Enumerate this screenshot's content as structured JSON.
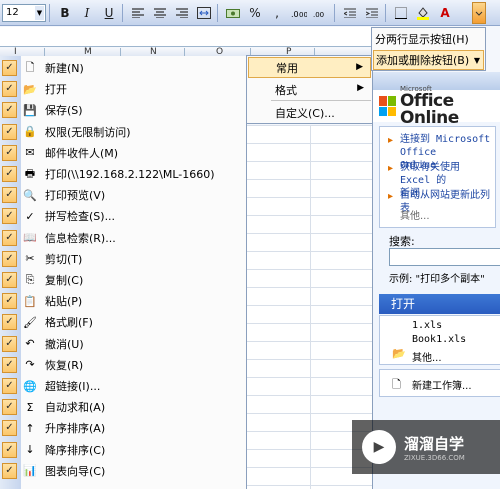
{
  "toolbar": {
    "font_size": "12",
    "buttons": [
      {
        "name": "bold-button",
        "glyph": "B"
      },
      {
        "name": "italic-button",
        "glyph": "I"
      },
      {
        "name": "underline-button",
        "glyph": "U"
      }
    ],
    "percent_glyph": "%",
    "comma_glyph": ",",
    "font_color_glyph": "A"
  },
  "column_headers": [
    "I",
    "M",
    "N",
    "O",
    "P"
  ],
  "commands": [
    {
      "label": "新建(N)",
      "icon": "new-document-icon",
      "glyph": "🗋"
    },
    {
      "label": "打开",
      "icon": "open-folder-icon",
      "glyph": "📂"
    },
    {
      "label": "保存(S)",
      "icon": "save-icon",
      "glyph": "💾"
    },
    {
      "label": "权限(无限制访问)",
      "icon": "permission-icon",
      "glyph": "🔒"
    },
    {
      "label": "邮件收件人(M)",
      "icon": "mail-icon",
      "glyph": "✉"
    },
    {
      "label": "打印(\\\\192.168.2.122\\ML-1660)",
      "icon": "print-icon",
      "glyph": "🖶"
    },
    {
      "label": "打印预览(V)",
      "icon": "print-preview-icon",
      "glyph": "🔍"
    },
    {
      "label": "拼写检查(S)...",
      "icon": "spelling-icon",
      "glyph": "✓"
    },
    {
      "label": "信息检索(R)...",
      "icon": "research-icon",
      "glyph": "📖"
    },
    {
      "label": "剪切(T)",
      "icon": "cut-icon",
      "glyph": "✂"
    },
    {
      "label": "复制(C)",
      "icon": "copy-icon",
      "glyph": "⎘"
    },
    {
      "label": "粘贴(P)",
      "icon": "paste-icon",
      "glyph": "📋"
    },
    {
      "label": "格式刷(F)",
      "icon": "format-painter-icon",
      "glyph": "🖌"
    },
    {
      "label": "撤消(U)",
      "icon": "undo-icon",
      "glyph": "↶"
    },
    {
      "label": "恢复(R)",
      "icon": "redo-icon",
      "glyph": "↷"
    },
    {
      "label": "超链接(I)...",
      "icon": "hyperlink-icon",
      "glyph": "🌐"
    },
    {
      "label": "自动求和(A)",
      "icon": "autosum-icon",
      "glyph": "Σ"
    },
    {
      "label": "升序排序(A)",
      "icon": "sort-ascending-icon",
      "glyph": "↑"
    },
    {
      "label": "降序排序(C)",
      "icon": "sort-descending-icon",
      "glyph": "↓"
    },
    {
      "label": "图表向导(C)",
      "icon": "chart-wizard-icon",
      "glyph": "📊"
    }
  ],
  "check_glyph": "✓",
  "category_menu": {
    "items": [
      {
        "label": "常用",
        "has_submenu": true,
        "selected": true
      },
      {
        "label": "格式",
        "has_submenu": true,
        "selected": false
      },
      {
        "label": "自定义(C)...",
        "has_submenu": false,
        "selected": false
      }
    ]
  },
  "options_popup": {
    "items": [
      {
        "label": "分两行显示按钮(H)",
        "selected": false
      },
      {
        "label": "添加或删除按钮(B)",
        "selected": true
      }
    ]
  },
  "task_pane": {
    "logo_small": "Microsoft",
    "logo_big": "Office Online",
    "links": [
      {
        "text": "连接到 Microsoft Office",
        "line2": "Online"
      },
      {
        "text": "获取有关使用 Excel 的",
        "line2": "新闻"
      },
      {
        "text": "自动从网站更新此列表",
        "line2": ""
      }
    ],
    "more": "其他...",
    "search_label": "搜索:",
    "search_value": "",
    "example": "示例: \"打印多个副本\"",
    "open_header": "打开",
    "files": [
      "1.xls",
      "Book1.xls"
    ],
    "open_more": "其他...",
    "new_workbook": "新建工作簿..."
  },
  "watermark": {
    "title": "溜溜自学",
    "subtitle": "ZIXUE.3D66.COM"
  },
  "colors": {
    "check_bg": "#fbc66a",
    "highlight": "#ffeec2",
    "taskpane_header": "#2a5cc0",
    "link": "#1d46a3"
  }
}
